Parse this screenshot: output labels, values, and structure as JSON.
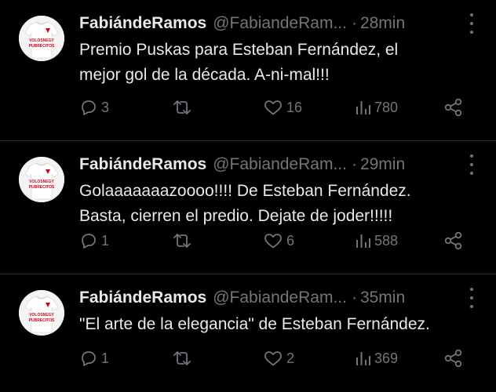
{
  "tweets": [
    {
      "name": "FabiándeRamos",
      "handle": "@FabiandeRam...",
      "separator": "·",
      "time": "28min",
      "text_lines": [
        "Premio Puskas para Esteban Fernández, el",
        "mejor gol de la década. A-ni-mal!!!"
      ],
      "replies": "3",
      "retweets": "",
      "likes": "16",
      "views": "780",
      "avatar_text": [
        "VOLOSNEGY",
        "PUBRECITOS"
      ]
    },
    {
      "name": "FabiándeRamos",
      "handle": "@FabiandeRam...",
      "separator": "·",
      "time": "29min",
      "text_lines": [
        "Golaaaaaaazoooo!!!! De Esteban Fernández.",
        "Basta, cierren el predio. Dejate de joder!!!!!"
      ],
      "replies": "1",
      "retweets": "",
      "likes": "6",
      "views": "588",
      "avatar_text": [
        "VOLOSNEGY",
        "PUBRECITOS"
      ]
    },
    {
      "name": "FabiándeRamos",
      "handle": "@FabiandeRam...",
      "separator": "·",
      "time": "35min",
      "text_lines": [
        "\"El arte de la elegancia\" de Esteban Fernández."
      ],
      "replies": "1",
      "retweets": "",
      "likes": "2",
      "views": "369",
      "avatar_text": [
        "VOLOSNEGY",
        "PUBRECITOS"
      ]
    }
  ],
  "colors": {
    "background": "#000000",
    "primary_text": "#e7e9ea",
    "secondary_text": "#71767b",
    "divider": "#2f3336",
    "shirt_red": "#d0021b"
  },
  "icons": [
    "avatar-icon",
    "more-icon",
    "reply-icon",
    "retweet-icon",
    "like-icon",
    "views-icon",
    "share-icon"
  ]
}
